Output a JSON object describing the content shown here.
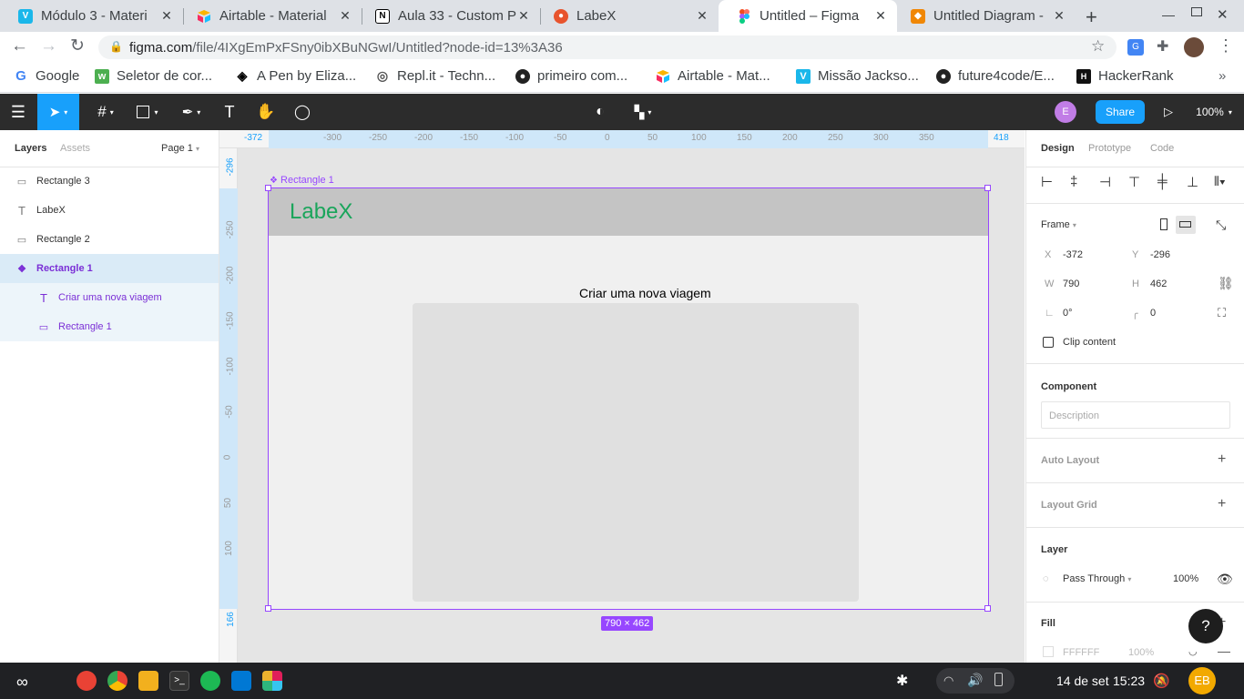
{
  "browser": {
    "tabs": [
      {
        "title": "Módulo 3 - Materi",
        "icon": "vimeo-icon",
        "color": "#1ab7ea",
        "glyph": "V"
      },
      {
        "title": "Airtable - Material",
        "icon": "airtable-icon",
        "color": "#fcb400",
        "glyph": ""
      },
      {
        "title": "Aula 33 - Custom P",
        "icon": "notion-icon",
        "color": "#000000",
        "glyph": "N"
      },
      {
        "title": "LabeX",
        "icon": "labex-icon",
        "color": "#e8542d",
        "glyph": "L"
      },
      {
        "title": "Untitled – Figma",
        "icon": "figma-icon",
        "color": "#f24e1e",
        "glyph": ""
      },
      {
        "title": "Untitled Diagram -",
        "icon": "drawio-icon",
        "color": "#f08705",
        "glyph": ""
      }
    ],
    "url_host": "figma.com",
    "url_path": "/file/4IXgEmPxFSny0ibXBuNGwI/Untitled?node-id=13%3A36",
    "bookmarks": [
      {
        "label": "Google",
        "icon": "google-icon"
      },
      {
        "label": "Seletor de cor...",
        "icon": "color-picker-icon"
      },
      {
        "label": "A Pen by Eliza...",
        "icon": "codepen-icon"
      },
      {
        "label": "Repl.it - Techn...",
        "icon": "replit-icon"
      },
      {
        "label": "primeiro com...",
        "icon": "github-icon"
      },
      {
        "label": "Airtable - Mat...",
        "icon": "airtable-icon"
      },
      {
        "label": "Missão Jackso...",
        "icon": "vimeo-icon"
      },
      {
        "label": "future4code/E...",
        "icon": "github-icon"
      },
      {
        "label": "HackerRank",
        "icon": "hackerrank-icon"
      }
    ]
  },
  "figma": {
    "user_initial": "E",
    "share_label": "Share",
    "zoom": "100%",
    "layers_tabs": {
      "layers": "Layers",
      "assets": "Assets",
      "page": "Page 1"
    },
    "layers": [
      {
        "name": "Rectangle 3",
        "type": "rect"
      },
      {
        "name": "LabeX",
        "type": "text"
      },
      {
        "name": "Rectangle 2",
        "type": "rect"
      },
      {
        "name": "Rectangle 1",
        "type": "component",
        "selected": true
      },
      {
        "name": "Criar uma nova viagem",
        "type": "text",
        "child": true
      },
      {
        "name": "Rectangle 1",
        "type": "rect",
        "child": true
      }
    ],
    "ruler": {
      "h_ticks": [
        "-300",
        "-250",
        "-200",
        "-150",
        "-100",
        "-50",
        "0",
        "50",
        "100",
        "150",
        "200",
        "250",
        "300",
        "350"
      ],
      "h_start": "-372",
      "h_end": "418",
      "v_ticks": [
        "-250",
        "-200",
        "-150",
        "-100",
        "-50",
        "0",
        "50",
        "100"
      ],
      "v_start": "-296",
      "v_end": "166"
    },
    "frame": {
      "label": "Rectangle 1",
      "brand": "LabeX",
      "heading": "Criar uma nova viagem",
      "size_badge": "790 × 462"
    },
    "props": {
      "tabs": [
        "Design",
        "Prototype",
        "Code"
      ],
      "frame_label": "Frame",
      "x_label": "X",
      "x": "-372",
      "y_label": "Y",
      "y": "-296",
      "w_label": "W",
      "w": "790",
      "h_label": "H",
      "h": "462",
      "rotation": "0°",
      "radius": "0",
      "clip_content": "Clip content",
      "component_title": "Component",
      "description_placeholder": "Description",
      "auto_layout": "Auto Layout",
      "layout_grid": "Layout Grid",
      "layer_title": "Layer",
      "blend": "Pass Through",
      "opacity": "100%",
      "fill_title": "Fill",
      "fill_hex": "FFFFFF",
      "fill_opacity": "100%",
      "help": "?"
    }
  },
  "taskbar": {
    "date": "14 de set",
    "time": "15:23",
    "user": "EB"
  },
  "colors": {
    "figma_blue": "#18a0fb",
    "selection": "#9747ff",
    "brand_green": "#1aa55b",
    "header_gray": "#c4c4c4"
  }
}
